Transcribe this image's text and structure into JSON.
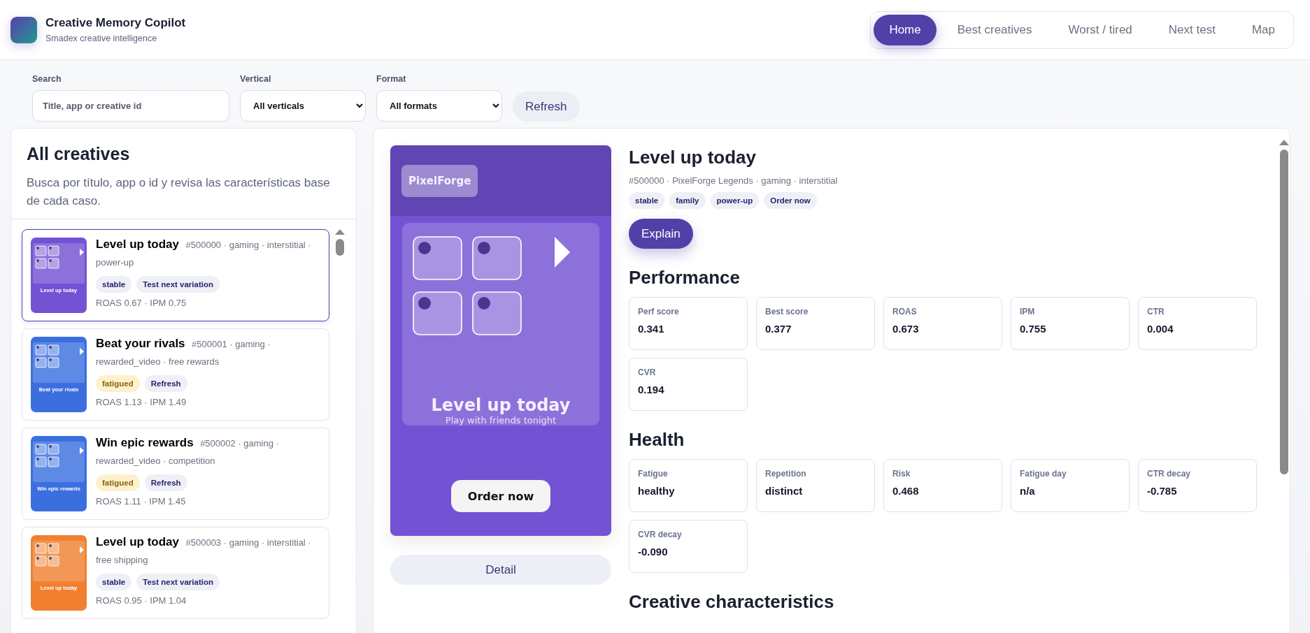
{
  "app": {
    "title": "Creative Memory Copilot",
    "subtitle": "Smadex creative intelligence"
  },
  "nav": [
    {
      "label": "Home",
      "selected": true
    },
    {
      "label": "Best creatives",
      "selected": false
    },
    {
      "label": "Worst / tired",
      "selected": false
    },
    {
      "label": "Next test",
      "selected": false
    },
    {
      "label": "Map",
      "selected": false
    }
  ],
  "filters": {
    "search": {
      "label": "Search",
      "placeholder": "Title, app or creative id"
    },
    "vertical": {
      "label": "Vertical",
      "value": "All verticals"
    },
    "format": {
      "label": "Format",
      "value": "All formats"
    },
    "refresh_button": "Refresh"
  },
  "list": {
    "title": "All creatives",
    "description": "Busca por título, app o id y revisa las características base de cada caso.",
    "items": [
      {
        "title": "Level up today",
        "meta": "#500000 · gaming · interstitial · power-up",
        "tags": [
          {
            "label": "stable",
            "kind": "neutral"
          },
          {
            "label": "Test next variation",
            "kind": "neutral"
          }
        ],
        "metrics": "ROAS 0.67 · IPM 0.75",
        "color": "#7452d4",
        "thumb_text": "Level up today",
        "selected": true
      },
      {
        "title": "Beat your rivals",
        "meta": "#500001 · gaming · rewarded_video · free rewards",
        "tags": [
          {
            "label": "fatigued",
            "kind": "warning"
          },
          {
            "label": "Refresh",
            "kind": "neutral"
          }
        ],
        "metrics": "ROAS 1.13 · IPM 1.49",
        "color": "#3b6fe0",
        "thumb_text": "Beat your rivals",
        "selected": false
      },
      {
        "title": "Win epic rewards",
        "meta": "#500002 · gaming · rewarded_video · competition",
        "tags": [
          {
            "label": "fatigued",
            "kind": "warning"
          },
          {
            "label": "Refresh",
            "kind": "neutral"
          }
        ],
        "metrics": "ROAS 1.11 · IPM 1.45",
        "color": "#3b6fe0",
        "thumb_text": "Win epic rewards",
        "selected": false
      },
      {
        "title": "Level up today",
        "meta": "#500003 · gaming · interstitial · free shipping",
        "tags": [
          {
            "label": "stable",
            "kind": "neutral"
          },
          {
            "label": "Test next variation",
            "kind": "neutral"
          }
        ],
        "metrics": "ROAS 0.95 · IPM 1.04",
        "color": "#f08030",
        "thumb_text": "Level up today",
        "selected": false
      }
    ]
  },
  "preview": {
    "brand": "PixelForge",
    "headline": "Level up today",
    "subline": "Play with friends tonight",
    "cta": "Order now",
    "color": "#7452d4",
    "detail_button": "Detail"
  },
  "detail": {
    "title": "Level up today",
    "meta": "#500000 · PixelForge Legends · gaming · interstitial",
    "tags": [
      "stable",
      "family",
      "power-up",
      "Order now"
    ],
    "explain_button": "Explain",
    "sections": [
      {
        "title": "Performance",
        "metrics": [
          {
            "label": "Perf score",
            "value": "0.341"
          },
          {
            "label": "Best score",
            "value": "0.377"
          },
          {
            "label": "ROAS",
            "value": "0.673"
          },
          {
            "label": "IPM",
            "value": "0.755"
          },
          {
            "label": "CTR",
            "value": "0.004"
          },
          {
            "label": "CVR",
            "value": "0.194"
          }
        ]
      },
      {
        "title": "Health",
        "metrics": [
          {
            "label": "Fatigue",
            "value": "healthy"
          },
          {
            "label": "Repetition",
            "value": "distinct"
          },
          {
            "label": "Risk",
            "value": "0.468"
          },
          {
            "label": "Fatigue day",
            "value": "n/a"
          },
          {
            "label": "CTR decay",
            "value": "-0.785"
          },
          {
            "label": "CVR decay",
            "value": "-0.090"
          }
        ]
      },
      {
        "title": "Creative characteristics"
      }
    ]
  }
}
